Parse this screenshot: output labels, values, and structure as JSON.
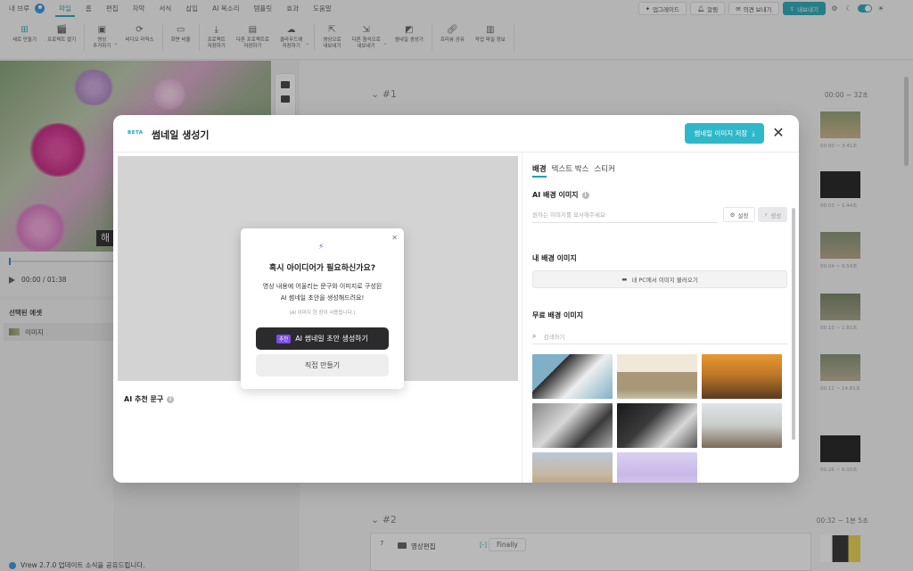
{
  "menubar": {
    "user_label": "내 브루",
    "items": [
      "파일",
      "홈",
      "편집",
      "자막",
      "서식",
      "삽입",
      "AI 목소리",
      "템플릿",
      "효과",
      "도움말"
    ],
    "active_index": 0,
    "upgrade_label": "업그레이드",
    "notify_label": "알림",
    "feedback_label": "의견 보내기",
    "export_label": "내보내기"
  },
  "toolbar": {
    "items": [
      {
        "label": "새로 만들기",
        "icon": "plus-square-icon"
      },
      {
        "label": "프로젝트 열기",
        "icon": "clapper-icon"
      },
      {
        "label": "영상\n추가하기",
        "icon": "video-add-icon",
        "has_menu": true
      },
      {
        "label": "비디오 리믹스",
        "icon": "remix-icon"
      },
      {
        "label": "화면 비율",
        "icon": "aspect-ratio-icon"
      },
      {
        "label": "프로젝트\n저장하기",
        "icon": "download-icon"
      },
      {
        "label": "다른 프로젝트로\n저장하기",
        "icon": "save-as-icon"
      },
      {
        "label": "클라우드에\n저장하기",
        "icon": "cloud-icon",
        "has_menu": true
      },
      {
        "label": "영상으로\n내보내기",
        "icon": "export-video-icon"
      },
      {
        "label": "다른 형식으로\n내보내기",
        "icon": "export-other-icon",
        "has_menu": true
      },
      {
        "label": "썸네일 생성기",
        "icon": "thumbnail-icon"
      },
      {
        "label": "프리뷰 공유",
        "icon": "link-icon"
      },
      {
        "label": "작업 파일 정보",
        "icon": "info-file-icon"
      }
    ]
  },
  "player": {
    "time": "00:00 / 01:38",
    "caption_char": "해"
  },
  "side_panel": {
    "title": "선택된 애셋",
    "item_label": "이미지"
  },
  "update_notice": "Vrew 2.7.0 업데이트 소식을 공유드립니다.",
  "script": {
    "section1": {
      "label": "#1",
      "time": "00:00 ~ 32초"
    },
    "section2": {
      "label": "#2",
      "time": "00:32 ~ 1분 5초"
    },
    "thumb_times": [
      "00:00 ~ 3.41초",
      "00:03 ~ 1.44초",
      "00:04 ~ 6.54초",
      "00:10 ~ 1.81초",
      "00:12 ~ 14.81초",
      "00:26 ~ 6.00초"
    ],
    "clip": {
      "number": "7",
      "label": "영상편집",
      "tag": "[-]",
      "word": "Finally"
    }
  },
  "modal": {
    "beta": "BETA",
    "title": "썸네일 생성기",
    "save_label": "썸네일 이미지 저장",
    "ai_recommend_label": "AI 추천 문구",
    "popup": {
      "title": "혹시 아이디어가 필요하신가요?",
      "desc_line1": "영상 내용에 어울리는 문구와 이미지로 구성된",
      "desc_line2": "AI 썸네일 초안을 생성해드려요!",
      "note": "(AI 이미지 한 장이 사용됩니다.)",
      "badge": "추천",
      "primary_label": "AI 썸네일 초안 생성하기",
      "secondary_label": "직접 만들기"
    },
    "tabs": [
      "배경",
      "텍스트 박스",
      "스티커"
    ],
    "active_tab": 0,
    "ai_bg": {
      "heading": "AI 배경 이미지",
      "placeholder": "원하는 이미지를 묘사해주세요",
      "settings_label": "설정",
      "generate_label": "생성"
    },
    "my_bg": {
      "heading": "내 배경 이미지",
      "button_label": "내 PC에서 이미지 불러오기"
    },
    "free_bg": {
      "heading": "무료 배경 이미지",
      "search_placeholder": "검색하기",
      "images": [
        "sketch-figure",
        "cabinet-room",
        "forest-sunset",
        "laptop-desk",
        "tablet-desk",
        "cat-lying",
        "city-skyline",
        "purple-clouds"
      ]
    }
  },
  "colors": {
    "accent": "#1aa3b3",
    "save_button": "#2eb8c9",
    "primary_dark": "#2b2b2d",
    "badge_purple": "#7a4ee0"
  }
}
